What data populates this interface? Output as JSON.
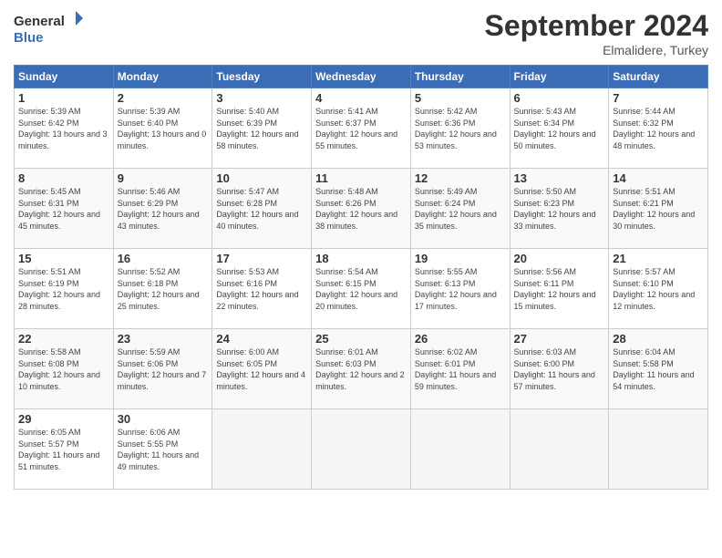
{
  "header": {
    "logo_line1": "General",
    "logo_line2": "Blue",
    "month": "September 2024",
    "location": "Elmalidere, Turkey"
  },
  "days_of_week": [
    "Sunday",
    "Monday",
    "Tuesday",
    "Wednesday",
    "Thursday",
    "Friday",
    "Saturday"
  ],
  "weeks": [
    [
      {
        "num": "1",
        "sunrise": "5:39 AM",
        "sunset": "6:42 PM",
        "daylight": "13 hours and 3 minutes."
      },
      {
        "num": "2",
        "sunrise": "5:39 AM",
        "sunset": "6:40 PM",
        "daylight": "13 hours and 0 minutes."
      },
      {
        "num": "3",
        "sunrise": "5:40 AM",
        "sunset": "6:39 PM",
        "daylight": "12 hours and 58 minutes."
      },
      {
        "num": "4",
        "sunrise": "5:41 AM",
        "sunset": "6:37 PM",
        "daylight": "12 hours and 55 minutes."
      },
      {
        "num": "5",
        "sunrise": "5:42 AM",
        "sunset": "6:36 PM",
        "daylight": "12 hours and 53 minutes."
      },
      {
        "num": "6",
        "sunrise": "5:43 AM",
        "sunset": "6:34 PM",
        "daylight": "12 hours and 50 minutes."
      },
      {
        "num": "7",
        "sunrise": "5:44 AM",
        "sunset": "6:32 PM",
        "daylight": "12 hours and 48 minutes."
      }
    ],
    [
      {
        "num": "8",
        "sunrise": "5:45 AM",
        "sunset": "6:31 PM",
        "daylight": "12 hours and 45 minutes."
      },
      {
        "num": "9",
        "sunrise": "5:46 AM",
        "sunset": "6:29 PM",
        "daylight": "12 hours and 43 minutes."
      },
      {
        "num": "10",
        "sunrise": "5:47 AM",
        "sunset": "6:28 PM",
        "daylight": "12 hours and 40 minutes."
      },
      {
        "num": "11",
        "sunrise": "5:48 AM",
        "sunset": "6:26 PM",
        "daylight": "12 hours and 38 minutes."
      },
      {
        "num": "12",
        "sunrise": "5:49 AM",
        "sunset": "6:24 PM",
        "daylight": "12 hours and 35 minutes."
      },
      {
        "num": "13",
        "sunrise": "5:50 AM",
        "sunset": "6:23 PM",
        "daylight": "12 hours and 33 minutes."
      },
      {
        "num": "14",
        "sunrise": "5:51 AM",
        "sunset": "6:21 PM",
        "daylight": "12 hours and 30 minutes."
      }
    ],
    [
      {
        "num": "15",
        "sunrise": "5:51 AM",
        "sunset": "6:19 PM",
        "daylight": "12 hours and 28 minutes."
      },
      {
        "num": "16",
        "sunrise": "5:52 AM",
        "sunset": "6:18 PM",
        "daylight": "12 hours and 25 minutes."
      },
      {
        "num": "17",
        "sunrise": "5:53 AM",
        "sunset": "6:16 PM",
        "daylight": "12 hours and 22 minutes."
      },
      {
        "num": "18",
        "sunrise": "5:54 AM",
        "sunset": "6:15 PM",
        "daylight": "12 hours and 20 minutes."
      },
      {
        "num": "19",
        "sunrise": "5:55 AM",
        "sunset": "6:13 PM",
        "daylight": "12 hours and 17 minutes."
      },
      {
        "num": "20",
        "sunrise": "5:56 AM",
        "sunset": "6:11 PM",
        "daylight": "12 hours and 15 minutes."
      },
      {
        "num": "21",
        "sunrise": "5:57 AM",
        "sunset": "6:10 PM",
        "daylight": "12 hours and 12 minutes."
      }
    ],
    [
      {
        "num": "22",
        "sunrise": "5:58 AM",
        "sunset": "6:08 PM",
        "daylight": "12 hours and 10 minutes."
      },
      {
        "num": "23",
        "sunrise": "5:59 AM",
        "sunset": "6:06 PM",
        "daylight": "12 hours and 7 minutes."
      },
      {
        "num": "24",
        "sunrise": "6:00 AM",
        "sunset": "6:05 PM",
        "daylight": "12 hours and 4 minutes."
      },
      {
        "num": "25",
        "sunrise": "6:01 AM",
        "sunset": "6:03 PM",
        "daylight": "12 hours and 2 minutes."
      },
      {
        "num": "26",
        "sunrise": "6:02 AM",
        "sunset": "6:01 PM",
        "daylight": "11 hours and 59 minutes."
      },
      {
        "num": "27",
        "sunrise": "6:03 AM",
        "sunset": "6:00 PM",
        "daylight": "11 hours and 57 minutes."
      },
      {
        "num": "28",
        "sunrise": "6:04 AM",
        "sunset": "5:58 PM",
        "daylight": "11 hours and 54 minutes."
      }
    ],
    [
      {
        "num": "29",
        "sunrise": "6:05 AM",
        "sunset": "5:57 PM",
        "daylight": "11 hours and 51 minutes."
      },
      {
        "num": "30",
        "sunrise": "6:06 AM",
        "sunset": "5:55 PM",
        "daylight": "11 hours and 49 minutes."
      },
      null,
      null,
      null,
      null,
      null
    ]
  ]
}
